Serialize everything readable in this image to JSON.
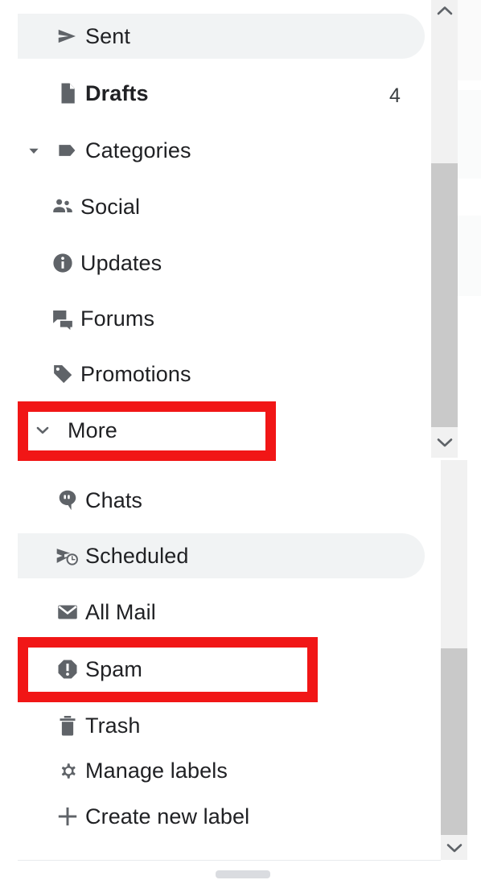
{
  "app": {
    "name": "Gmail",
    "panel": "mail-folder-navigation-sidebar"
  },
  "colors": {
    "annotation_red": "#f11616",
    "selected_row_bg": "#f1f3f4",
    "icon_gray": "#5f6368",
    "text_primary": "#202124",
    "scrollbar_track": "#f1f1f1",
    "scrollbar_thumb": "#c9c9c9"
  },
  "sidebar": {
    "items": [
      {
        "id": "sent",
        "label": "Sent",
        "icon": "send-icon",
        "count": "",
        "indent": "top",
        "selected": true,
        "bold": false,
        "twisty": "none",
        "highlighted": false
      },
      {
        "id": "drafts",
        "label": "Drafts",
        "icon": "draft-document-icon",
        "count": "4",
        "indent": "top",
        "selected": false,
        "bold": true,
        "twisty": "none",
        "highlighted": false
      },
      {
        "id": "categories",
        "label": "Categories",
        "icon": "label-tag-icon",
        "count": "",
        "indent": "top",
        "selected": false,
        "bold": false,
        "twisty": "expanded",
        "highlighted": false
      },
      {
        "id": "social",
        "label": "Social",
        "icon": "people-group-icon",
        "count": "",
        "indent": "sub",
        "selected": false,
        "bold": false,
        "twisty": "none",
        "highlighted": false
      },
      {
        "id": "updates",
        "label": "Updates",
        "icon": "info-circle-icon",
        "count": "",
        "indent": "sub",
        "selected": false,
        "bold": false,
        "twisty": "none",
        "highlighted": false
      },
      {
        "id": "forums",
        "label": "Forums",
        "icon": "forum-chat-icon",
        "count": "",
        "indent": "sub",
        "selected": false,
        "bold": false,
        "twisty": "none",
        "highlighted": false
      },
      {
        "id": "promotions",
        "label": "Promotions",
        "icon": "price-tag-icon",
        "count": "",
        "indent": "sub",
        "selected": false,
        "bold": false,
        "twisty": "none",
        "highlighted": false
      },
      {
        "id": "more",
        "label": "More",
        "icon": "none",
        "count": "",
        "indent": "top",
        "selected": false,
        "bold": false,
        "twisty": "collapsed-chevron-down",
        "highlighted": true
      },
      {
        "id": "chats",
        "label": "Chats",
        "icon": "chat-bubble-icon",
        "count": "",
        "indent": "top",
        "selected": false,
        "bold": false,
        "twisty": "none",
        "highlighted": false
      },
      {
        "id": "scheduled",
        "label": "Scheduled",
        "icon": "scheduled-send-icon",
        "count": "",
        "indent": "top",
        "selected": true,
        "bold": false,
        "twisty": "none",
        "highlighted": false
      },
      {
        "id": "all-mail",
        "label": "All Mail",
        "icon": "envelope-icon",
        "count": "",
        "indent": "top",
        "selected": false,
        "bold": false,
        "twisty": "none",
        "highlighted": false
      },
      {
        "id": "spam",
        "label": "Spam",
        "icon": "spam-exclamation-icon",
        "count": "",
        "indent": "top",
        "selected": false,
        "bold": false,
        "twisty": "none",
        "highlighted": true
      },
      {
        "id": "trash",
        "label": "Trash",
        "icon": "trash-bin-icon",
        "count": "",
        "indent": "top",
        "selected": false,
        "bold": false,
        "twisty": "none",
        "highlighted": false
      },
      {
        "id": "manage-labels",
        "label": "Manage labels",
        "icon": "gear-icon",
        "count": "",
        "indent": "top",
        "selected": false,
        "bold": false,
        "twisty": "none",
        "highlighted": false
      },
      {
        "id": "create-new-label",
        "label": "Create new label",
        "icon": "plus-icon",
        "count": "",
        "indent": "top",
        "selected": false,
        "bold": false,
        "twisty": "none",
        "highlighted": false
      }
    ]
  },
  "scrollbars": {
    "inner": {
      "name": "inner-list-vertical-scrollbar",
      "up_arrow": "chevron-up-icon",
      "down_arrow": "chevron-down-icon"
    },
    "outer": {
      "name": "outer-panel-vertical-scrollbar",
      "down_arrow": "chevron-down-icon"
    },
    "horizontal": {
      "name": "horizontal-scrollbar-thumb"
    }
  },
  "annotations": [
    {
      "target": "more",
      "shape": "rectangle",
      "color": "#f11616"
    },
    {
      "target": "spam",
      "shape": "rectangle",
      "color": "#f11616"
    }
  ]
}
